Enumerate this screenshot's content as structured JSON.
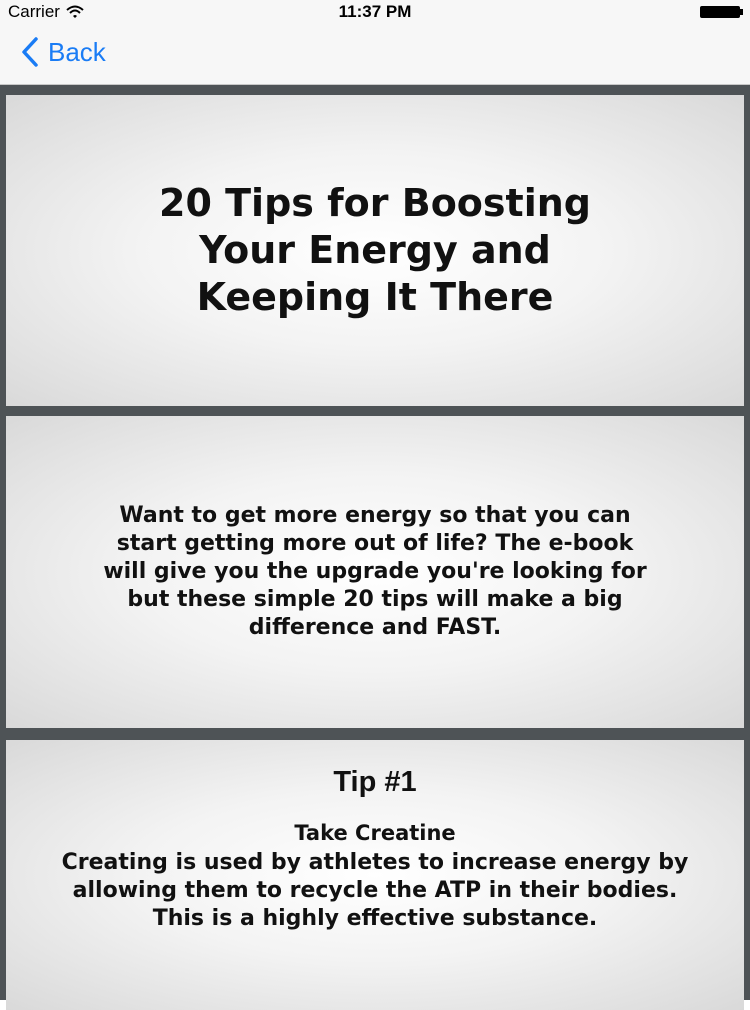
{
  "status_bar": {
    "carrier": "Carrier",
    "time": "11:37 PM",
    "icons": [
      "wifi-icon",
      "battery-icon"
    ]
  },
  "nav": {
    "back_label": "Back",
    "accent_color": "#1a7cf5"
  },
  "panels": {
    "title": "20 Tips for Boosting Your Energy and Keeping It There",
    "intro": "Want to get more energy so that you can start getting more out of life? The e-book will give you the upgrade you're looking for but these simple 20 tips will make a big difference and FAST.",
    "tip": {
      "number": "Tip #1",
      "heading": "Take Creatine",
      "body": "Creating is used by athletes to increase energy by allowing them to recycle the ATP in their bodies. This is a highly effective substance."
    }
  }
}
